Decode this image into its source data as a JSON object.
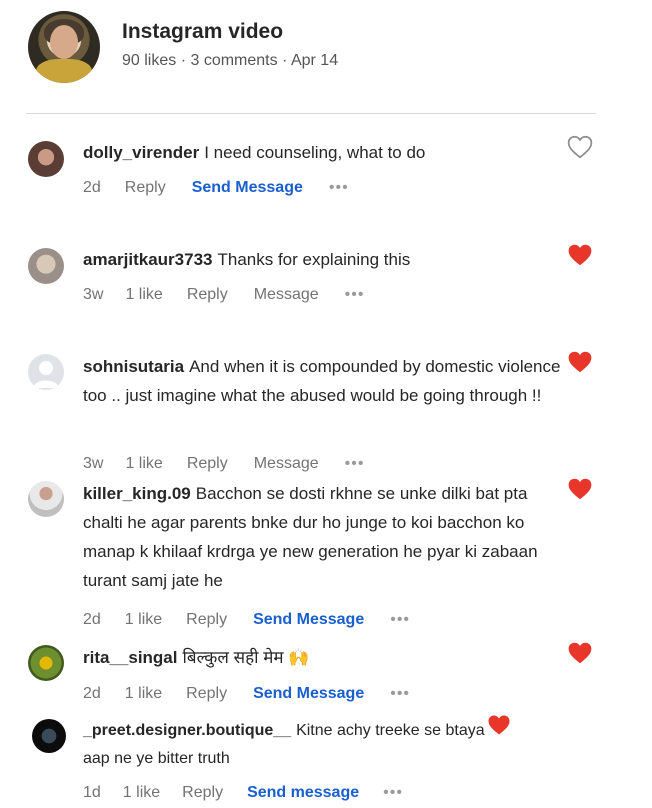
{
  "post": {
    "title": "Instagram video",
    "meta": "90 likes · 3 comments · Apr 14"
  },
  "comments": [
    {
      "user": "dolly_virender",
      "text": "I need counseling, what to do",
      "time": "2d",
      "likes": "",
      "reply": "Reply",
      "message": "Send Message",
      "more": "•••",
      "liked": false
    },
    {
      "user": "amarjitkaur3733",
      "text": "Thanks for explaining this",
      "time": "3w",
      "likes": "1 like",
      "reply": "Reply",
      "message": "Message",
      "more": "•••",
      "liked": true
    },
    {
      "user": "sohnisutaria",
      "text": "And when it is compounded by domestic violence too .. just imagine what the abused would be going through !!",
      "time": "3w",
      "likes": "1 like",
      "reply": "Reply",
      "message": "Message",
      "more": "•••",
      "liked": true
    },
    {
      "user": "killer_king.09",
      "text": "Bacchon se dosti rkhne se unke dilki bat pta chalti he agar parents bnke dur ho junge to koi bacchon ko manap k khilaaf krdrga ye new generation he pyar ki zabaan turant samj jate he",
      "time": "2d",
      "likes": "1 like",
      "reply": "Reply",
      "message": "Send Message",
      "more": "•••",
      "liked": true
    },
    {
      "user": "rita__singal",
      "text": "बिल्कुल सही मेम 🙌",
      "time": "2d",
      "likes": "1 like",
      "reply": "Reply",
      "message": "Send Message",
      "more": "•••",
      "liked": true
    },
    {
      "user": "_preet.designer.boutique__",
      "text": "Kitne achy treeke se btaya aap ne ye bitter truth",
      "time": "1d",
      "likes": "1 like",
      "reply": "Reply",
      "message": "Send message",
      "more": "•••",
      "liked": true
    }
  ],
  "colors": {
    "heart": "#e8362a",
    "link": "#1a5fd0",
    "muted": "#737373"
  }
}
